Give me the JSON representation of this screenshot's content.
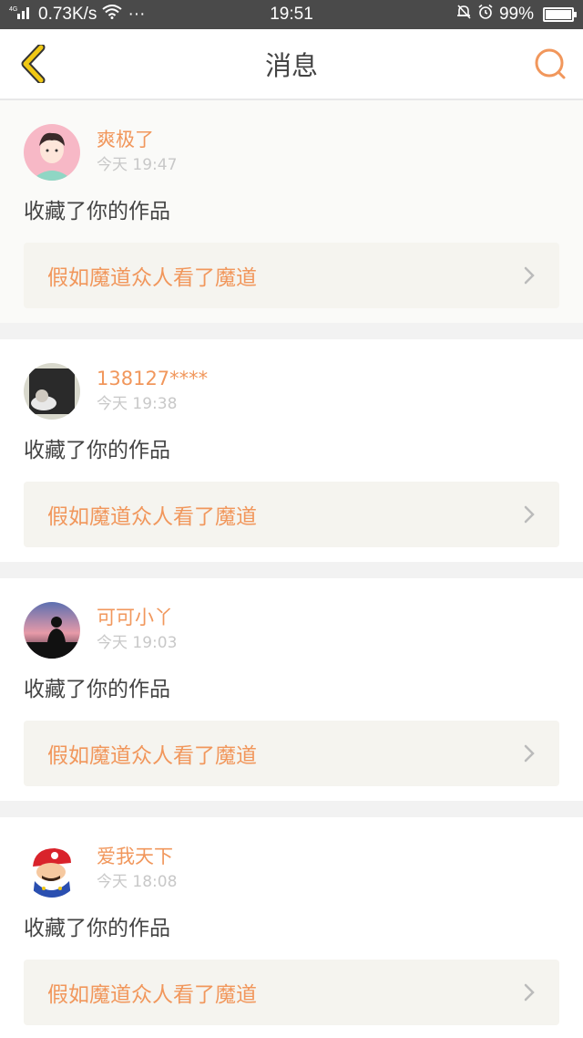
{
  "status": {
    "network": "4G",
    "speed": "0.73K/s",
    "more": "···",
    "time": "19:51",
    "battery": "99%",
    "battery_level": 0.99
  },
  "nav": {
    "title": "消息"
  },
  "messages": [
    {
      "user": "爽极了",
      "time": "今天 19:47",
      "action": "收藏了你的作品",
      "work": "假如魔道众人看了魔道"
    },
    {
      "user": "138127****",
      "time": "今天 19:38",
      "action": "收藏了你的作品",
      "work": "假如魔道众人看了魔道"
    },
    {
      "user": "可可小丫",
      "time": "今天 19:03",
      "action": "收藏了你的作品",
      "work": "假如魔道众人看了魔道"
    },
    {
      "user": "爱我天下",
      "time": "今天 18:08",
      "action": "收藏了你的作品",
      "work": "假如魔道众人看了魔道"
    }
  ],
  "colors": {
    "accent": "#f1975c",
    "back_icon": "#f0c814",
    "status_bar": "#4a4a4a"
  }
}
